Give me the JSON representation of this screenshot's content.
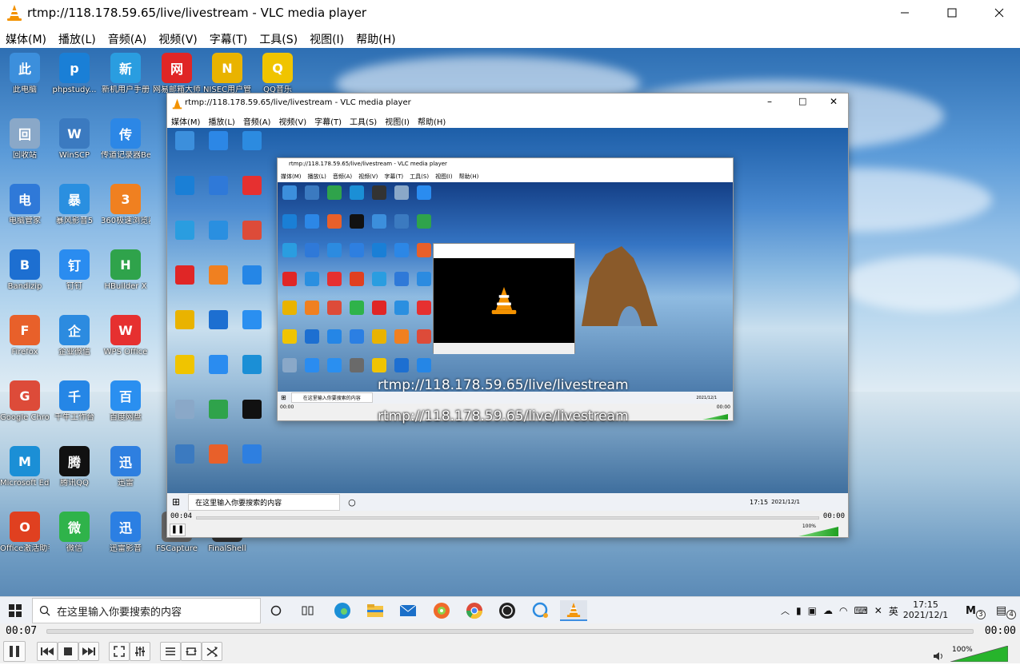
{
  "window": {
    "title": "rtmp://118.178.59.65/live/livestream - VLC media player"
  },
  "menu": [
    "媒体(M)",
    "播放(L)",
    "音频(A)",
    "视频(V)",
    "字幕(T)",
    "工具(S)",
    "视图(I)",
    "帮助(H)"
  ],
  "desktop": {
    "icons": [
      {
        "label": "此电脑",
        "icon": "computer-icon",
        "color": "#3c8fdc"
      },
      {
        "label": "phpstudy...",
        "icon": "phpstudy-icon",
        "color": "#1a7fd6"
      },
      {
        "label": "新机用户手册",
        "icon": "manual-icon",
        "color": "#2a9de0"
      },
      {
        "label": "网易邮箱大师",
        "icon": "hp-icon",
        "color": "#e02626"
      },
      {
        "label": "NISEC用户管",
        "icon": "nisec-icon",
        "color": "#e9b300"
      },
      {
        "label": "QQ音乐",
        "icon": "qqmusic-icon",
        "color": "#f0c400"
      },
      {
        "label": "回收站",
        "icon": "recycle-bin-icon",
        "color": "#8aa8c8"
      },
      {
        "label": "WinSCP",
        "icon": "winscp-icon",
        "color": "#3b7ac0"
      },
      {
        "label": "传道记录器Beta版",
        "icon": "pen-icon",
        "color": "#2c87e6"
      },
      {
        "label": "电脑管家",
        "icon": "pc-manager-icon",
        "color": "#2f79d8"
      },
      {
        "label": "暴风影音5",
        "icon": "storm-icon",
        "color": "#2a8fe0"
      },
      {
        "label": "360极速浏览器",
        "icon": "360-browser-icon",
        "color": "#f08020"
      },
      {
        "label": "Bandizip",
        "icon": "bandizip-icon",
        "color": "#1d6fd1"
      },
      {
        "label": "钉钉",
        "icon": "dingtalk-icon",
        "color": "#2a8cf0"
      },
      {
        "label": "HBuilder X",
        "icon": "hbuilder-icon",
        "color": "#2fa34b"
      },
      {
        "label": "Firefox",
        "icon": "firefox-icon",
        "color": "#e8602a"
      },
      {
        "label": "企业微信",
        "icon": "wecom-icon",
        "color": "#2c8be0"
      },
      {
        "label": "WPS Office",
        "icon": "wps-icon",
        "color": "#e63030"
      },
      {
        "label": "Google Chrome",
        "icon": "chrome-icon",
        "color": "#dd4b39"
      },
      {
        "label": "千牛工作台",
        "icon": "qianniu-icon",
        "color": "#2586e6"
      },
      {
        "label": "百度网盘",
        "icon": "baidu-netdisk-icon",
        "color": "#2a8ff0"
      },
      {
        "label": "Microsoft Edge",
        "icon": "edge-icon",
        "color": "#1b8fd6"
      },
      {
        "label": "腾讯QQ",
        "icon": "qq-icon",
        "color": "#111111"
      },
      {
        "label": "迅雷",
        "icon": "thunder-icon",
        "color": "#2e7fe0"
      },
      {
        "label": "Office激活助手",
        "icon": "office-icon",
        "color": "#e04020"
      },
      {
        "label": "微信",
        "icon": "wechat-icon",
        "color": "#2fb34a"
      },
      {
        "label": "迅雷影音",
        "icon": "thunder-video-icon",
        "color": "#2b7fe3"
      },
      {
        "label": "FSCapture",
        "icon": "fscapture-icon",
        "color": "#6a6a6a"
      },
      {
        "label": "FinalShell",
        "icon": "finalshell-icon",
        "color": "#333333"
      }
    ]
  },
  "video": {
    "subtitle": "rtmp://118.178.59.65/live/livestream"
  },
  "taskbar": {
    "search_placeholder": "在这里输入你要搜索的内容",
    "ime": "英",
    "time": "17:15",
    "date": "2021/12/1",
    "notif_count": "3",
    "msg_count": "4"
  },
  "nested": {
    "elapsed": "00:04",
    "total": "00:00",
    "volume": "100%"
  },
  "playback": {
    "elapsed": "00:07",
    "total": "00:00",
    "volume": "100%",
    "progress": 0
  },
  "colors": {
    "vlc_orange": "#f39200",
    "volume_green": "#27b42c"
  }
}
